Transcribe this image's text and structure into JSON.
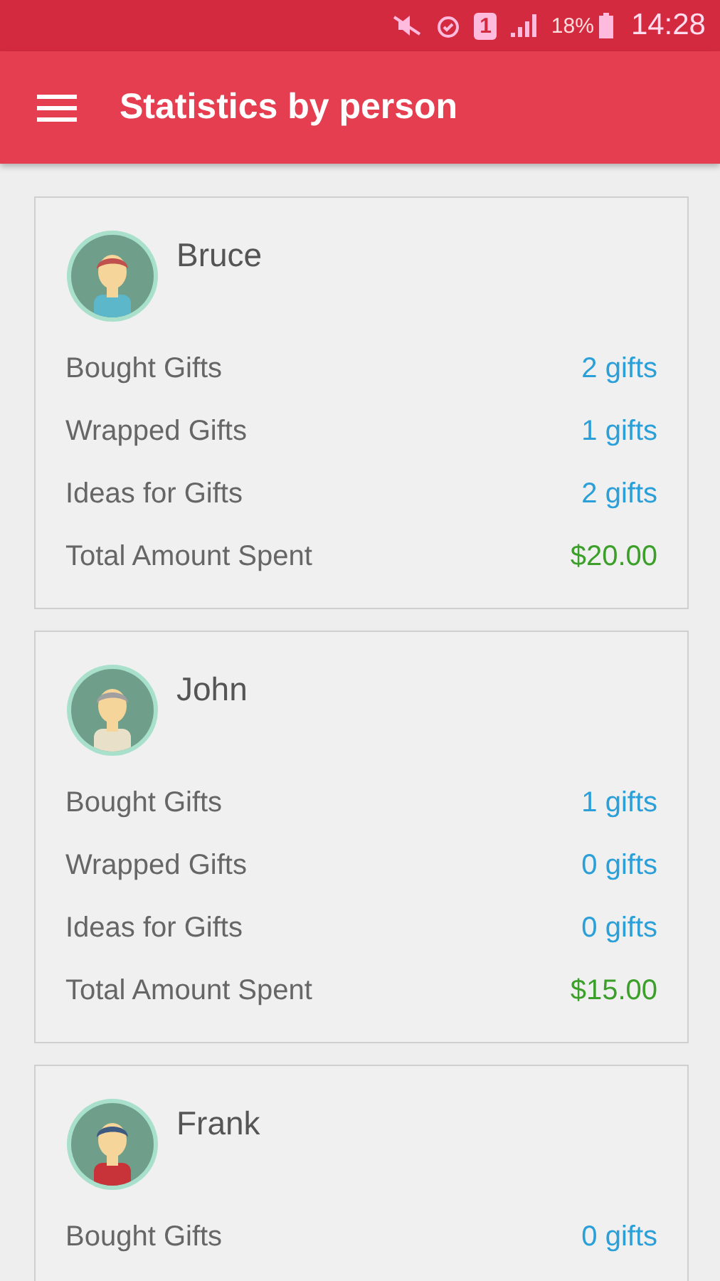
{
  "status_bar": {
    "sim": "1",
    "battery": "18%",
    "time": "14:28"
  },
  "app_bar": {
    "title": "Statistics by person"
  },
  "people": [
    {
      "name": "Bruce",
      "avatar": {
        "kind": "redhead"
      },
      "stats": [
        {
          "label": "Bought Gifts",
          "value": "2 gifts",
          "kind": "count"
        },
        {
          "label": "Wrapped Gifts",
          "value": "1 gifts",
          "kind": "count"
        },
        {
          "label": "Ideas for Gifts",
          "value": "2 gifts",
          "kind": "count"
        },
        {
          "label": "Total Amount Spent",
          "value": "$20.00",
          "kind": "money"
        }
      ]
    },
    {
      "name": "John",
      "avatar": {
        "kind": "elder"
      },
      "stats": [
        {
          "label": "Bought Gifts",
          "value": "1 gifts",
          "kind": "count"
        },
        {
          "label": "Wrapped Gifts",
          "value": "0 gifts",
          "kind": "count"
        },
        {
          "label": "Ideas for Gifts",
          "value": "0 gifts",
          "kind": "count"
        },
        {
          "label": "Total Amount Spent",
          "value": "$15.00",
          "kind": "money"
        }
      ]
    },
    {
      "name": "Frank",
      "avatar": {
        "kind": "glasses"
      },
      "stats": [
        {
          "label": "Bought Gifts",
          "value": "0 gifts",
          "kind": "count"
        }
      ]
    }
  ]
}
